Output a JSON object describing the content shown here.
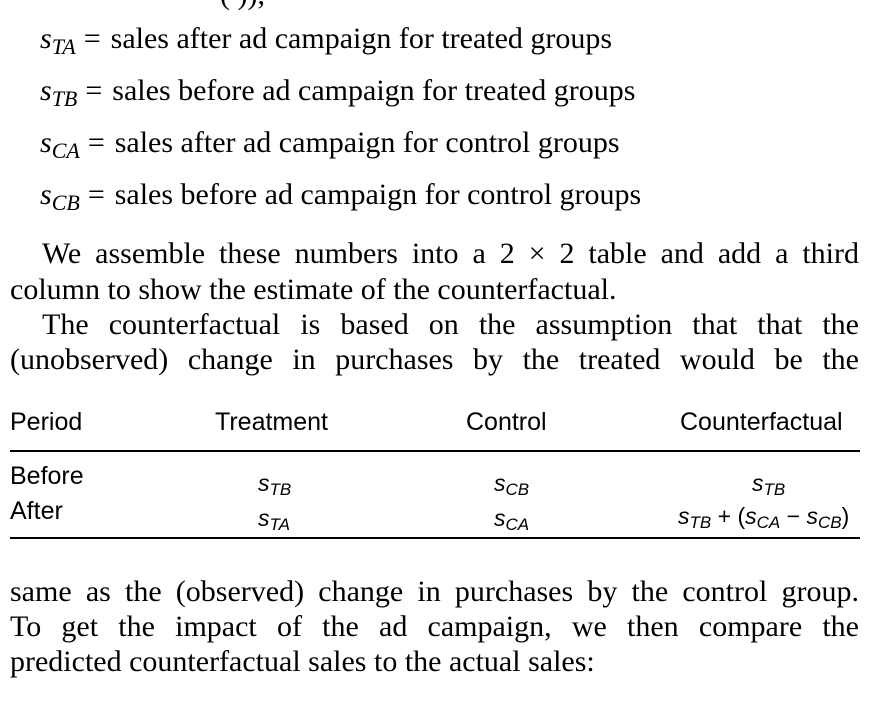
{
  "top_clip": "(               )),",
  "definitions": [
    {
      "symbol": "s",
      "sub": "TA",
      "eq": "=",
      "text": "sales after ad campaign for treated groups"
    },
    {
      "symbol": "s",
      "sub": "TB",
      "eq": "=",
      "text": "sales before ad campaign for treated groups"
    },
    {
      "symbol": "s",
      "sub": "CA",
      "eq": "=",
      "text": "sales after ad campaign for control groups"
    },
    {
      "symbol": "s",
      "sub": "CB",
      "eq": "=",
      "text": "sales before ad campaign for control groups"
    }
  ],
  "para1_line1": "We assemble these numbers into a 2 × 2 table and add a third",
  "para1_line2": "column to show the estimate of the counterfactual.",
  "para2_line1": "The counterfactual is based on the assumption that that the",
  "para2_line2": "(unobserved) change in purchases by the treated would be the",
  "table": {
    "headers": [
      "Period",
      "Treatment",
      "Control",
      "Counterfactual"
    ],
    "rows": [
      {
        "label": "Before",
        "treatment_sub": "TB",
        "control_sub": "CB",
        "counterfactual_sub": "TB"
      },
      {
        "label": "After",
        "treatment_sub": "TA",
        "control_sub": "CA",
        "cf_parts": {
          "s": "s",
          "sub1": "TB",
          "plus": " + (",
          "sub2": "CA",
          "minus": " − ",
          "sub3": "CB",
          "close": ")"
        }
      }
    ]
  },
  "para3_line1": "same as the (observed) change in purchases by the control group.",
  "para3_line2": "To get the impact of the ad campaign, we then compare the",
  "para3_line3": "predicted counterfactual sales to the actual sales:"
}
